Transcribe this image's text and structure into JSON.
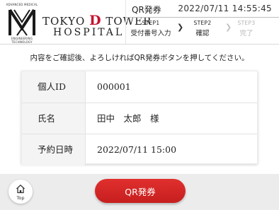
{
  "header": {
    "logo": {
      "top_caption": "ADVANCED MEDICAL",
      "bottom_caption_1": "ENGINEERING",
      "bottom_caption_2": "TECHNOLOGY"
    },
    "hospital_name_pre": "TOKYO ",
    "hospital_name_d": "D",
    "hospital_name_post": " TOWER",
    "hospital_name_line2": "HOSPITAL",
    "screen_title": "QR発券",
    "datetime": "2022/07/11 14:55:45"
  },
  "steps": [
    {
      "label": "STEP1",
      "name": "受付番号入力",
      "state": "done"
    },
    {
      "label": "STEP2",
      "name": "確認",
      "state": "current"
    },
    {
      "label": "STEP3",
      "name": "完了",
      "state": "upcoming"
    }
  ],
  "instruction": "内容をご確認後、よろしければQR発券ボタンを押してください。",
  "details": [
    {
      "label": "個人ID",
      "value": "000001"
    },
    {
      "label": "氏名",
      "value": "田中　太郎　様"
    },
    {
      "label": "予約日時",
      "value": "2022/07/11 15:00"
    }
  ],
  "footer": {
    "top_label": "Top",
    "issue_button_label": "QR発券"
  },
  "colors": {
    "accent_red": "#c8102e",
    "button_red": "#d42626",
    "footer_bg": "#ececec"
  }
}
